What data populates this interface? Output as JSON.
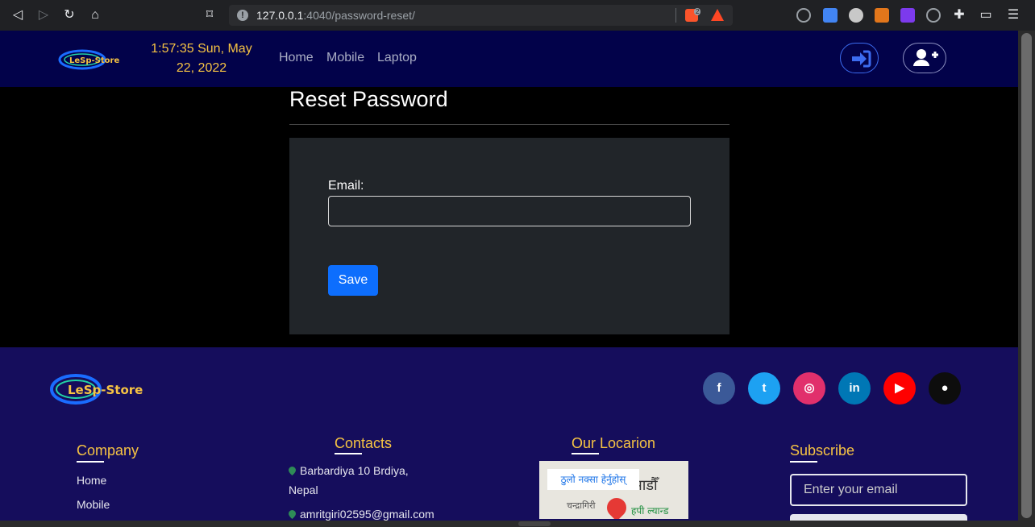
{
  "browser": {
    "url_host": "127.0.0.1",
    "url_path": ":4040/password-reset/",
    "brave_badge": "2"
  },
  "header": {
    "logo_text": "LeSp-Store",
    "clock_line1": "1:57:35 Sun, May",
    "clock_line2": "22, 2022",
    "nav": [
      "Home",
      "Mobile",
      "Laptop"
    ]
  },
  "main": {
    "title": "Reset Password",
    "email_label": "Email:",
    "email_value": "",
    "save_label": "Save"
  },
  "footer": {
    "logo_text": "LeSp-Store",
    "social": [
      {
        "icon": "facebook-icon",
        "glyph": "f",
        "color": "#3b5998"
      },
      {
        "icon": "twitter-icon",
        "glyph": "t",
        "color": "#1da1f2"
      },
      {
        "icon": "instagram-icon",
        "glyph": "◎",
        "color": "#e1306c"
      },
      {
        "icon": "linkedin-icon",
        "glyph": "in",
        "color": "#0077b5"
      },
      {
        "icon": "youtube-icon",
        "glyph": "▶",
        "color": "#ff0000"
      },
      {
        "icon": "github-icon",
        "glyph": "●",
        "color": "#0d0d0d"
      }
    ],
    "company": {
      "title": "Company",
      "links": [
        "Home",
        "Mobile"
      ]
    },
    "contacts": {
      "title": "Contacts",
      "address_line1": "Barbardiya 10 Brdiya,",
      "address_line2": "Nepal",
      "email": "amritgiri02595@gmail.com"
    },
    "location": {
      "title": "Our Locarion",
      "map_button": "ठुलो नक्सा हेर्नुहोस्",
      "map_city": "काठमाडौँ",
      "map_place1": "चन्द्रागिरी",
      "map_place2": "हपी ल्यान्ड"
    },
    "subscribe": {
      "title": "Subscribe",
      "placeholder": "Enter your email"
    }
  }
}
